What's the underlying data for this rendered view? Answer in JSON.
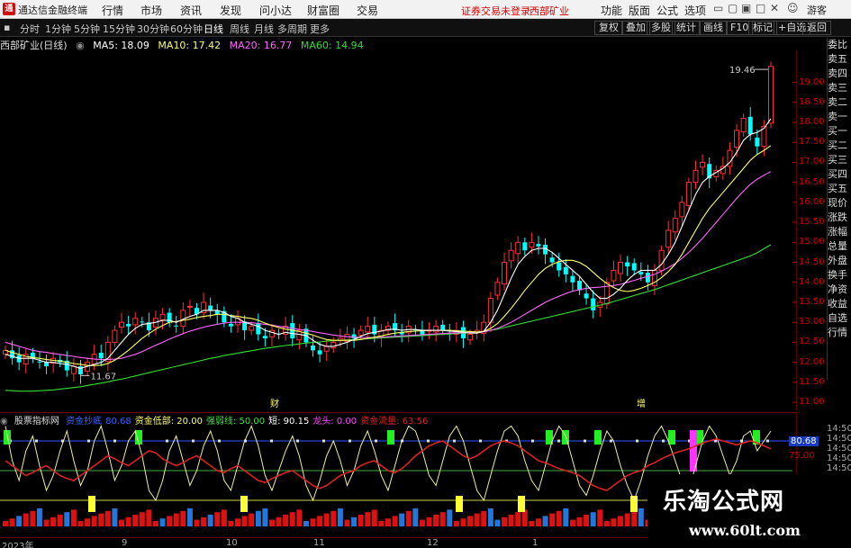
{
  "titlebar": {
    "app_name": "通达信金融终端",
    "menus": [
      "行情",
      "市场",
      "资讯",
      "发现",
      "问小达",
      "财富圈",
      "交易"
    ],
    "login_notice": "证券交易未登录",
    "stock_tag": "西部矿业",
    "right_menus": [
      "功能",
      "版面",
      "公式",
      "选项"
    ],
    "guest": "游客"
  },
  "toolbar": {
    "periods": [
      "分时",
      "1分钟",
      "5分钟",
      "15分钟",
      "30分钟",
      "60分钟",
      "日线",
      "周线",
      "月线",
      "多周期",
      "更多"
    ],
    "active_period": "日线",
    "buttons": [
      "复权",
      "叠加",
      "多股",
      "统计",
      "画线",
      "F10",
      "标记",
      "+自选",
      "返回"
    ]
  },
  "chart": {
    "stock_title": "西部矿业(日线)",
    "ma": [
      {
        "label": "MA5: 18.09",
        "color": "#ffffff"
      },
      {
        "label": "MA10: 17.42",
        "color": "#ffff66"
      },
      {
        "label": "MA20: 16.77",
        "color": "#ff66ff"
      },
      {
        "label": "MA60: 14.94",
        "color": "#33dd33"
      }
    ],
    "high_label": "19.46",
    "low_label": "11.67",
    "price_ticks": [
      "19.00",
      "18.50",
      "18.00",
      "17.50",
      "17.00",
      "16.50",
      "16.00",
      "15.50",
      "15.00",
      "14.50",
      "14.00",
      "13.50",
      "13.00",
      "12.50",
      "12.00",
      "11.50",
      "11.00"
    ],
    "markers": [
      "财",
      "增"
    ],
    "colors": {
      "up": "#ff3030",
      "down": "#00ffff",
      "axis": "#aa0000"
    }
  },
  "indicator": {
    "name": "股票指标网",
    "items": [
      {
        "label": "资金抄底",
        "color": "#3366ff"
      },
      {
        "label": "80.68",
        "color": "#3366ff"
      },
      {
        "label": "资金低部: 20.00",
        "color": "#ffff66"
      },
      {
        "label": "强弱线: 50.00",
        "color": "#44dd44"
      },
      {
        "label": "短: 90.15",
        "color": "#ffffff"
      },
      {
        "label": "龙头: 0.00",
        "color": "#ff44ff"
      },
      {
        "label": "资金流量: 63.56",
        "color": "#dd2222"
      }
    ],
    "axis_values": [
      "80.68",
      "75.00"
    ]
  },
  "side_panel": [
    "委比",
    "卖五",
    "卖四",
    "卖三",
    "卖二",
    "卖一",
    "买一",
    "买二",
    "买三",
    "买四",
    "买五",
    "现价",
    "涨跌",
    "涨幅",
    "总量",
    "外盘",
    "换手",
    "净资",
    "收益",
    "自选",
    "行情"
  ],
  "time_ticks": [
    "14:50",
    "14:50",
    "14:50",
    "14:50",
    "14:50",
    "14:50",
    "14:50",
    "14:50",
    "14:50",
    "14:50",
    "14:50",
    "14:50"
  ],
  "x_axis": [
    "2023年",
    "9",
    "10",
    "11",
    "12",
    "1"
  ],
  "watermark": {
    "title": "乐淘公式网",
    "url": "www.60lt.com"
  },
  "chart_data": {
    "type": "candlestick",
    "title": "西部矿业(日线)",
    "ylim": [
      10.8,
      19.8
    ],
    "close": [
      12.3,
      12.1,
      12.0,
      12.2,
      12.1,
      12.0,
      11.9,
      12.1,
      12.0,
      11.8,
      11.9,
      11.7,
      12.0,
      12.2,
      12.1,
      12.5,
      12.8,
      13.0,
      12.9,
      13.1,
      13.0,
      12.8,
      13.1,
      13.2,
      13.0,
      12.9,
      13.3,
      13.4,
      13.2,
      13.5,
      13.3,
      13.2,
      13.0,
      12.9,
      13.1,
      12.8,
      12.9,
      12.7,
      12.6,
      12.8,
      12.7,
      12.9,
      12.6,
      12.8,
      12.5,
      12.3,
      12.2,
      12.4,
      12.5,
      12.6,
      12.7,
      12.6,
      12.8,
      12.9,
      12.7,
      12.8,
      12.9,
      12.8,
      12.7,
      12.9,
      12.8,
      12.7,
      12.8,
      12.9,
      12.8,
      12.7,
      12.8,
      12.6,
      12.7,
      12.8,
      13.0,
      13.6,
      14.0,
      14.5,
      14.8,
      15.0,
      14.8,
      15.0,
      14.9,
      14.7,
      14.5,
      14.3,
      14.2,
      14.0,
      13.8,
      13.6,
      13.3,
      13.5,
      14.0,
      14.3,
      14.5,
      14.4,
      14.3,
      14.2,
      14.0,
      14.3,
      14.8,
      15.3,
      15.6,
      16.0,
      16.5,
      16.8,
      17.0,
      16.6,
      16.8,
      16.9,
      17.3,
      17.8,
      18.1,
      17.7,
      17.4,
      17.9,
      19.4
    ],
    "ma5": [
      12.2,
      12.15,
      12.1,
      12.1,
      12.1,
      12.05,
      12.0,
      12.0,
      11.97,
      11.95,
      11.9,
      11.85,
      11.9,
      11.95,
      12.0,
      12.1,
      12.3,
      12.5,
      12.7,
      12.85,
      12.95,
      12.97,
      13.0,
      13.05,
      13.05,
      13.0,
      13.08,
      13.15,
      13.2,
      13.3,
      13.3,
      13.3,
      13.25,
      13.15,
      13.1,
      13.0,
      12.95,
      12.9,
      12.8,
      12.75,
      12.7,
      12.75,
      12.72,
      12.7,
      12.67,
      12.55,
      12.45,
      12.4,
      12.4,
      12.45,
      12.5,
      12.57,
      12.65,
      12.72,
      12.75,
      12.78,
      12.82,
      12.83,
      12.8,
      12.82,
      12.82,
      12.8,
      12.8,
      12.8,
      12.8,
      12.78,
      12.77,
      12.75,
      12.73,
      12.73,
      12.78,
      13.0,
      13.3,
      13.7,
      14.1,
      14.45,
      14.65,
      14.8,
      14.85,
      14.85,
      14.75,
      14.6,
      14.45,
      14.3,
      14.15,
      13.95,
      13.75,
      13.6,
      13.6,
      13.7,
      13.85,
      14.05,
      14.2,
      14.3,
      14.3,
      14.3,
      14.45,
      14.7,
      15.0,
      15.4,
      15.8,
      16.2,
      16.5,
      16.65,
      16.75,
      16.85,
      17.0,
      17.25,
      17.55,
      17.7,
      17.75,
      17.85,
      18.09
    ],
    "ma10": [
      12.3,
      12.25,
      12.2,
      12.15,
      12.12,
      12.1,
      12.07,
      12.05,
      12.03,
      12.0,
      11.97,
      11.95,
      11.92,
      11.92,
      11.93,
      11.97,
      12.05,
      12.17,
      12.3,
      12.45,
      12.6,
      12.72,
      12.83,
      12.92,
      13.0,
      13.02,
      13.05,
      13.08,
      13.12,
      13.15,
      13.17,
      13.2,
      13.2,
      13.17,
      13.15,
      13.12,
      13.1,
      13.05,
      12.98,
      12.92,
      12.87,
      12.83,
      12.8,
      12.77,
      12.73,
      12.68,
      12.62,
      12.57,
      12.55,
      12.55,
      12.55,
      12.55,
      12.57,
      12.6,
      12.63,
      12.66,
      12.7,
      12.73,
      12.75,
      12.77,
      12.78,
      12.79,
      12.8,
      12.8,
      12.8,
      12.8,
      12.79,
      12.78,
      12.77,
      12.76,
      12.77,
      12.85,
      12.97,
      13.15,
      13.35,
      13.57,
      13.8,
      14.0,
      14.2,
      14.35,
      14.45,
      14.52,
      14.55,
      14.55,
      14.5,
      14.4,
      14.25,
      14.1,
      13.97,
      13.87,
      13.8,
      13.77,
      13.8,
      13.85,
      13.92,
      14.0,
      14.12,
      14.27,
      14.45,
      14.7,
      15.0,
      15.3,
      15.6,
      15.85,
      16.05,
      16.25,
      16.45,
      16.65,
      16.85,
      17.05,
      17.2,
      17.3,
      17.42
    ],
    "ma20": [
      12.5,
      12.45,
      12.4,
      12.35,
      12.3,
      12.27,
      12.25,
      12.22,
      12.2,
      12.17,
      12.15,
      12.12,
      12.1,
      12.08,
      12.07,
      12.07,
      12.08,
      12.1,
      12.15,
      12.2,
      12.27,
      12.35,
      12.43,
      12.5,
      12.58,
      12.65,
      12.72,
      12.78,
      12.83,
      12.88,
      12.92,
      12.95,
      12.98,
      13.0,
      13.0,
      13.0,
      12.99,
      12.97,
      12.95,
      12.93,
      12.9,
      12.88,
      12.85,
      12.82,
      12.8,
      12.77,
      12.74,
      12.71,
      12.68,
      12.66,
      12.64,
      12.63,
      12.62,
      12.62,
      12.62,
      12.63,
      12.64,
      12.65,
      12.66,
      12.67,
      12.68,
      12.69,
      12.7,
      12.71,
      12.72,
      12.73,
      12.74,
      12.74,
      12.75,
      12.75,
      12.76,
      12.8,
      12.85,
      12.92,
      13.0,
      13.1,
      13.2,
      13.3,
      13.4,
      13.5,
      13.58,
      13.65,
      13.72,
      13.78,
      13.82,
      13.85,
      13.87,
      13.88,
      13.9,
      13.92,
      13.95,
      14.0,
      14.05,
      14.1,
      14.15,
      14.2,
      14.28,
      14.37,
      14.47,
      14.6,
      14.75,
      14.92,
      15.1,
      15.3,
      15.5,
      15.7,
      15.9,
      16.1,
      16.28,
      16.45,
      16.58,
      16.68,
      16.77
    ],
    "ma60": [
      11.3,
      11.29,
      11.28,
      11.28,
      11.28,
      11.29,
      11.3,
      11.31,
      11.33,
      11.35,
      11.37,
      11.39,
      11.42,
      11.45,
      11.48,
      11.51,
      11.55,
      11.58,
      11.62,
      11.66,
      11.7,
      11.74,
      11.78,
      11.82,
      11.86,
      11.9,
      11.94,
      11.98,
      12.02,
      12.06,
      12.1,
      12.13,
      12.17,
      12.2,
      12.23,
      12.26,
      12.29,
      12.32,
      12.35,
      12.37,
      12.4,
      12.42,
      12.44,
      12.46,
      12.48,
      12.5,
      12.51,
      12.53,
      12.54,
      12.55,
      12.56,
      12.57,
      12.58,
      12.59,
      12.6,
      12.61,
      12.62,
      12.63,
      12.64,
      12.65,
      12.66,
      12.67,
      12.68,
      12.69,
      12.7,
      12.71,
      12.72,
      12.73,
      12.74,
      12.75,
      12.77,
      12.8,
      12.83,
      12.87,
      12.91,
      12.95,
      12.99,
      13.03,
      13.07,
      13.11,
      13.15,
      13.19,
      13.23,
      13.27,
      13.31,
      13.35,
      13.39,
      13.43,
      13.47,
      13.52,
      13.57,
      13.62,
      13.67,
      13.72,
      13.77,
      13.82,
      13.88,
      13.94,
      14.0,
      14.06,
      14.12,
      14.18,
      14.24,
      14.3,
      14.36,
      14.42,
      14.48,
      14.54,
      14.6,
      14.66,
      14.74,
      14.84,
      14.94
    ],
    "indicator_lines": {
      "short": [
        95,
        60,
        40,
        70,
        85,
        55,
        30,
        45,
        70,
        90,
        60,
        35,
        50,
        80,
        95,
        70,
        40,
        55,
        80,
        90,
        65,
        30,
        20,
        40,
        70,
        85,
        60,
        35,
        50,
        75,
        90,
        70,
        40,
        30,
        55,
        80,
        95,
        75,
        45,
        30,
        50,
        70,
        85,
        65,
        35,
        20,
        40,
        65,
        80,
        60,
        35,
        50,
        75,
        90,
        70,
        45,
        30,
        55,
        80,
        95,
        90,
        70,
        45,
        35,
        60,
        85,
        95,
        80,
        55,
        30,
        20,
        45,
        70,
        90,
        95,
        85,
        60,
        40,
        30,
        55,
        80,
        95,
        85,
        60,
        35,
        25,
        45,
        70,
        90,
        80,
        55,
        35,
        20,
        40,
        65,
        85,
        95,
        80,
        60,
        40,
        30,
        55,
        80,
        95,
        85,
        65,
        45,
        60,
        85,
        90,
        70,
        80,
        90
      ],
      "flow": [
        60,
        55,
        50,
        45,
        48,
        52,
        55,
        50,
        45,
        42,
        40,
        45,
        50,
        55,
        60,
        65,
        62,
        58,
        55,
        60,
        65,
        70,
        68,
        62,
        58,
        55,
        58,
        62,
        65,
        60,
        55,
        50,
        48,
        52,
        55,
        50,
        45,
        40,
        38,
        42,
        45,
        48,
        50,
        45,
        40,
        35,
        32,
        35,
        40,
        45,
        48,
        50,
        55,
        58,
        60,
        55,
        50,
        48,
        52,
        58,
        65,
        70,
        75,
        78,
        80,
        75,
        70,
        65,
        62,
        65,
        70,
        75,
        78,
        80,
        78,
        75,
        70,
        65,
        60,
        58,
        55,
        52,
        50,
        48,
        45,
        40,
        35,
        32,
        30,
        35,
        40,
        45,
        48,
        50,
        55,
        58,
        62,
        65,
        68,
        70,
        72,
        75,
        78,
        80,
        82,
        80,
        78,
        76,
        78,
        80,
        78,
        75,
        72
      ]
    }
  }
}
